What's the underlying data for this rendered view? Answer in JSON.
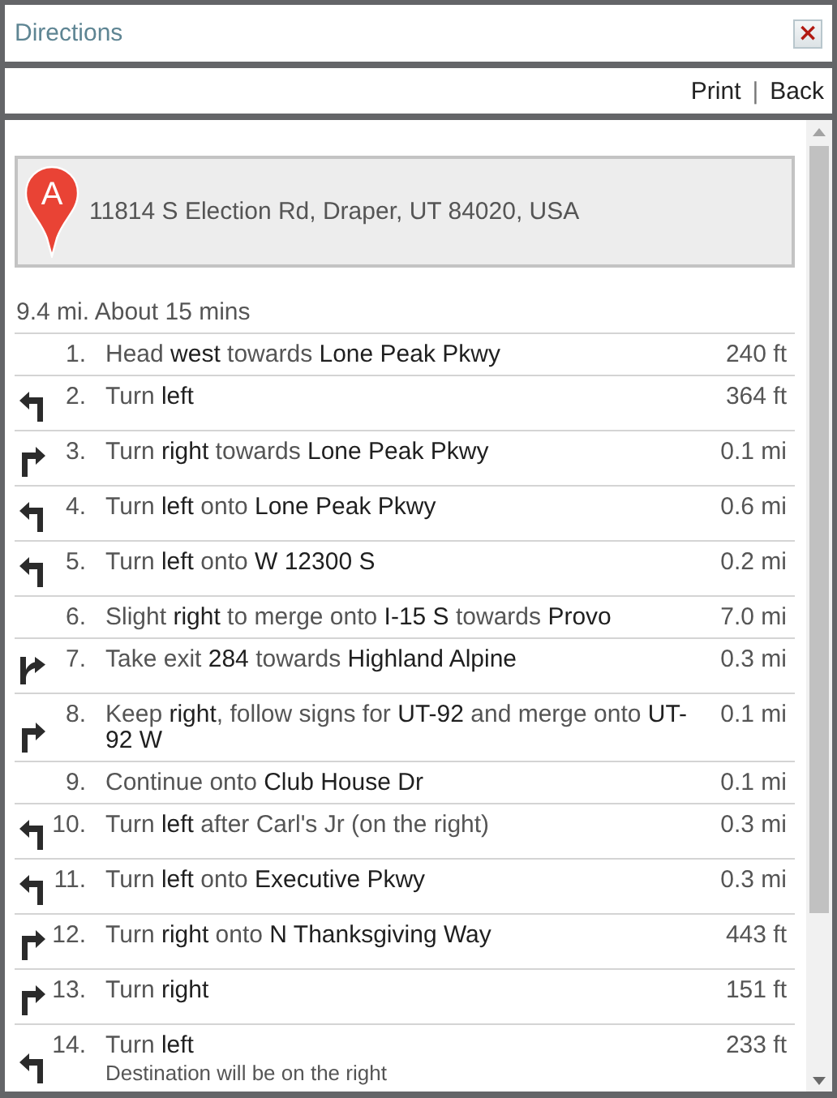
{
  "window": {
    "title": "Directions",
    "close": "×"
  },
  "toolbar": {
    "links": [
      "Print",
      "Back"
    ],
    "separator": "|"
  },
  "start": {
    "marker": "A",
    "address": "11814 S Election Rd, Draper, UT 84020, USA"
  },
  "summary": "9.4 mi. About 15 mins",
  "steps": [
    {
      "number": "1.",
      "kind": "none",
      "text": "Head **west** towards **Lone Peak Pkwy**",
      "distance": "240 ft"
    },
    {
      "number": "2.",
      "kind": "turn-left",
      "text": "Turn **left**",
      "distance": "364 ft"
    },
    {
      "number": "3.",
      "kind": "turn-right",
      "text": "Turn **right** towards **Lone Peak Pkwy**",
      "distance": "0.1 mi"
    },
    {
      "number": "4.",
      "kind": "turn-left",
      "text": "Turn **left** onto **Lone Peak Pkwy**",
      "distance": "0.6 mi"
    },
    {
      "number": "5.",
      "kind": "turn-left",
      "text": "Turn **left** onto **W 12300 S**",
      "distance": "0.2 mi"
    },
    {
      "number": "6.",
      "kind": "none",
      "text": "Slight **right** to merge onto **I-15 S** towards **Provo**",
      "distance": "7.0 mi"
    },
    {
      "number": "7.",
      "kind": "ramp-right",
      "text": "Take exit **284** towards **Highland Alpine**",
      "distance": "0.3 mi"
    },
    {
      "number": "8.",
      "kind": "turn-right",
      "text": "Keep **right**, follow signs for **UT-92** and merge onto **UT-92 W**",
      "distance": "0.1 mi"
    },
    {
      "number": "9.",
      "kind": "none",
      "text": "Continue onto **Club House Dr**",
      "distance": "0.1 mi"
    },
    {
      "number": "10.",
      "kind": "turn-left",
      "text": "Turn **left** after Carl's Jr (on the right)",
      "distance": "0.3 mi"
    },
    {
      "number": "11.",
      "kind": "turn-left",
      "text": "Turn **left** onto **Executive Pkwy**",
      "distance": "0.3 mi"
    },
    {
      "number": "12.",
      "kind": "turn-right",
      "text": "Turn **right** onto **N Thanksgiving Way**",
      "distance": "443 ft"
    },
    {
      "number": "13.",
      "kind": "turn-right",
      "text": "Turn **right**",
      "distance": "151 ft"
    },
    {
      "number": "14.",
      "kind": "turn-left",
      "text": "Turn **left**",
      "note": "Destination will be on the right",
      "distance": "233 ft"
    }
  ]
}
